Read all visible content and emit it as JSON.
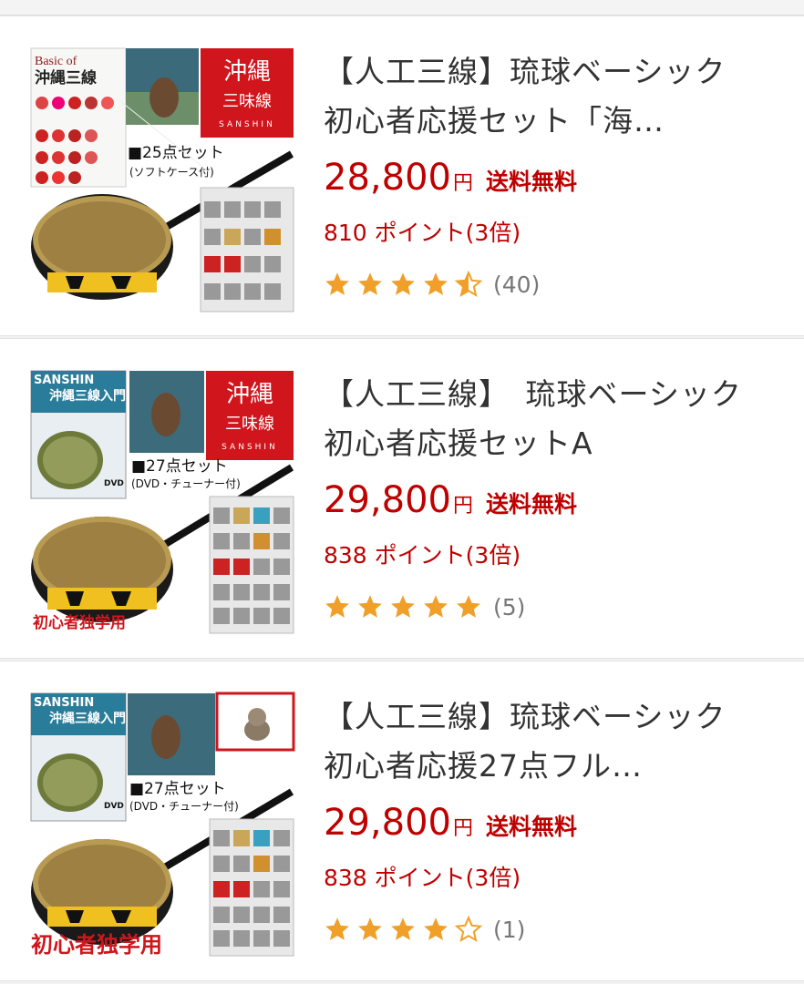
{
  "items": [
    {
      "title": "【人工三線】琉球ベーシック 初心者応援セット「海…",
      "price": "28,800",
      "yen": "円",
      "shipping": "送料無料",
      "points": "810 ポイント(3倍)",
      "rating": 4.5,
      "review_count": "(40)",
      "image_text": {
        "book_title_1": "Basic of",
        "book_title_2": "沖縄三線",
        "brand_1": "沖縄",
        "brand_2": "三味線",
        "brand_3": "SANSHIN",
        "set_label": "■25点セット",
        "set_sub": "(ソフトケース付)"
      }
    },
    {
      "title": "【人工三線】　琉球ベーシック初心者応援セットA",
      "price": "29,800",
      "yen": "円",
      "shipping": "送料無料",
      "points": "838 ポイント(3倍)",
      "rating": 5,
      "review_count": "(5)",
      "image_text": {
        "dvd_title_1": "SANSHIN",
        "dvd_title_2": "沖縄三線入門",
        "brand_1": "沖縄",
        "brand_2": "三味線",
        "brand_3": "SANSHIN",
        "set_label": "■27点セット",
        "set_sub": "(DVD・チューナー付)",
        "dvd_label": "DVD",
        "beginner": "初心者独学用"
      }
    },
    {
      "title": "【人工三線】琉球ベーシック　初心者応援27点フル…",
      "price": "29,800",
      "yen": "円",
      "shipping": "送料無料",
      "points": "838 ポイント(3倍)",
      "rating": 4,
      "review_count": "(1)",
      "image_text": {
        "dvd_title_1": "SANSHIN",
        "dvd_title_2": "沖縄三線入門",
        "set_label": "■27点セット",
        "set_sub": "(DVD・チューナー付)",
        "dvd_label": "DVD",
        "beginner": "初心者独学用"
      }
    }
  ],
  "colors": {
    "price_red": "#bf0000",
    "star_orange": "#f0a028",
    "star_empty": "#f0a028",
    "title_text": "#333333",
    "muted_text": "#777777",
    "brand_red": "#d0151c"
  },
  "icons": {
    "full_star": "star-full-icon",
    "half_star": "star-half-icon",
    "empty_star": "star-empty-icon"
  }
}
